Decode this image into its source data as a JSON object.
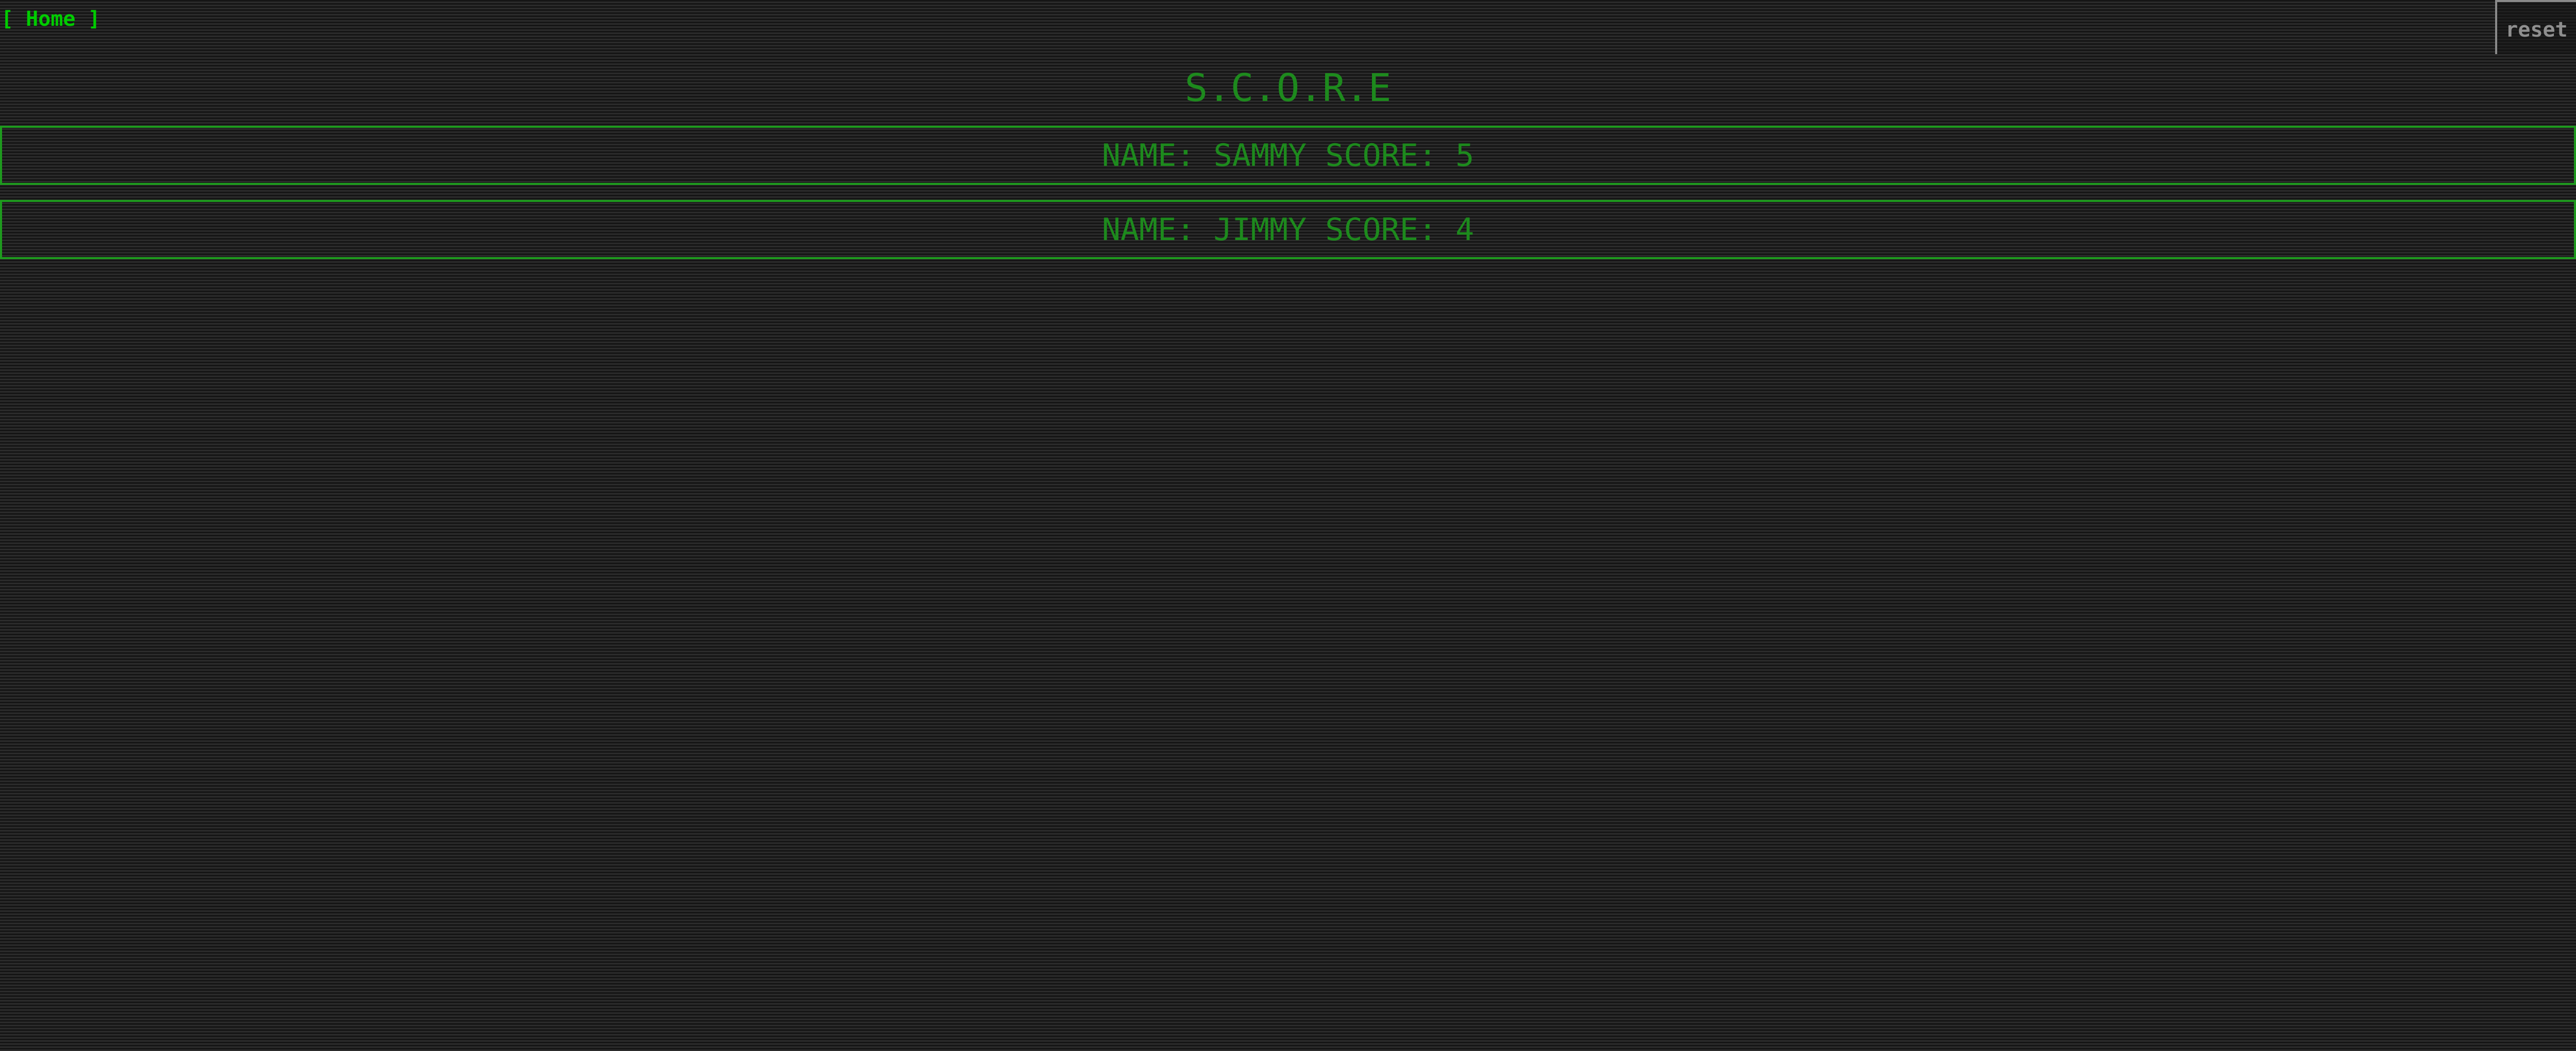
{
  "nav": {
    "home_label": "[ Home ]",
    "reset_label": "reset"
  },
  "title": "S.C.O.R.E",
  "scores": [
    {
      "text": "NAME: SAMMY SCORE: 5",
      "name": "SAMMY",
      "score": 5
    },
    {
      "text": "NAME: JIMMY SCORE: 4",
      "name": "JIMMY",
      "score": 4
    }
  ],
  "colors": {
    "accent": "#00cc00",
    "text_dim": "#1d8a1d",
    "border": "#1e9a1e",
    "button_text": "#8f8f8f"
  }
}
